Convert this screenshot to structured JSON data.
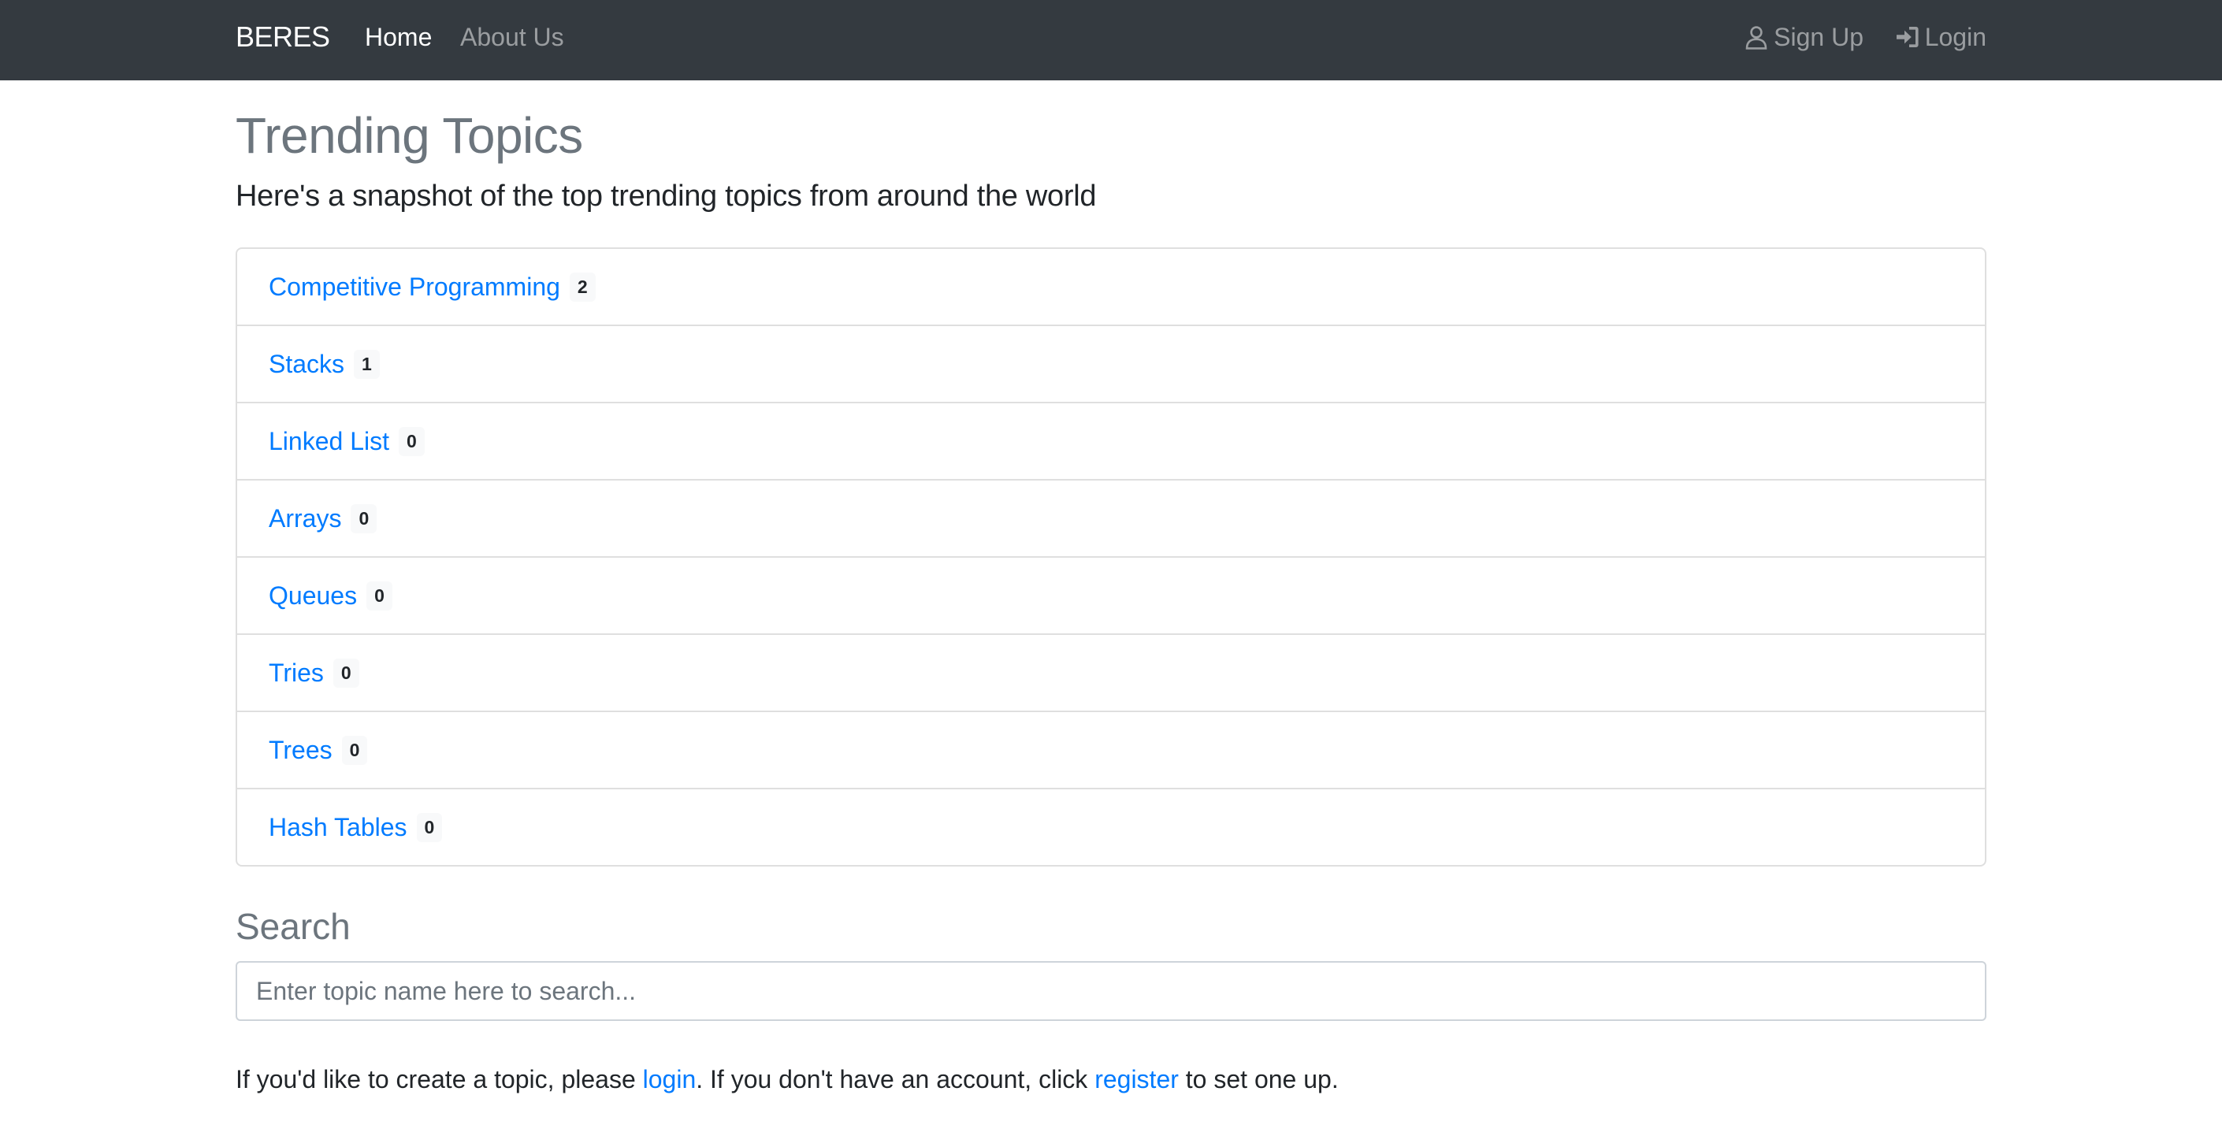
{
  "navbar": {
    "brand": "BERES",
    "links": {
      "home": "Home",
      "about": "About Us",
      "signup": "Sign Up",
      "login": "Login"
    },
    "icons": {
      "signup": "user-outline-icon",
      "login": "sign-in-icon"
    }
  },
  "main": {
    "title": "Trending Topics",
    "lead": "Here's a snapshot of the top trending topics from around the world",
    "topics": [
      {
        "name": "Competitive Programming",
        "count": "2"
      },
      {
        "name": "Stacks",
        "count": "1"
      },
      {
        "name": "Linked List",
        "count": "0"
      },
      {
        "name": "Arrays",
        "count": "0"
      },
      {
        "name": "Queues",
        "count": "0"
      },
      {
        "name": "Tries",
        "count": "0"
      },
      {
        "name": "Trees",
        "count": "0"
      },
      {
        "name": "Hash Tables",
        "count": "0"
      }
    ]
  },
  "search": {
    "heading": "Search",
    "placeholder": "Enter topic name here to search...",
    "value": ""
  },
  "footer": {
    "text_1": "If you'd like to create a topic, please ",
    "login_link": "login",
    "text_2": ". If you don't have an account, click ",
    "register_link": "register",
    "text_3": " to set one up."
  },
  "colors": {
    "navbar_bg": "#343a40",
    "link": "#007bff",
    "muted": "#6c757d"
  }
}
